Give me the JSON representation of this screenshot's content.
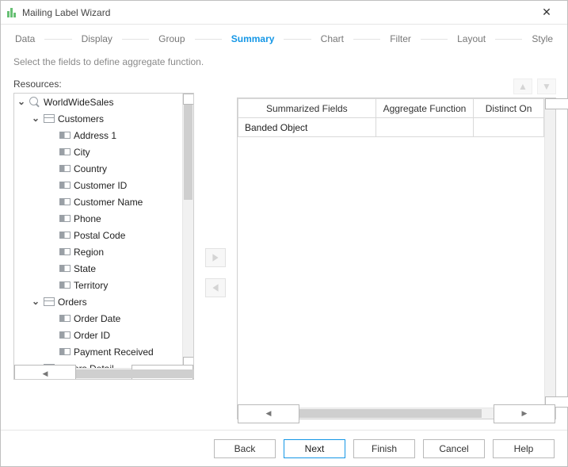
{
  "window": {
    "title": "Mailing Label Wizard"
  },
  "steps": {
    "items": [
      "Data",
      "Display",
      "Group",
      "Summary",
      "Chart",
      "Filter",
      "Layout",
      "Style"
    ],
    "active_index": 3
  },
  "instruction": "Select the fields to define aggregate function.",
  "left": {
    "label": "Resources:"
  },
  "tree": {
    "root": "WorldWideSales",
    "customers": {
      "label": "Customers",
      "fields": [
        "Address 1",
        "City",
        "Country",
        "Customer ID",
        "Customer Name",
        "Phone",
        "Postal Code",
        "Region",
        "State",
        "Territory"
      ]
    },
    "orders": {
      "label": "Orders",
      "fields": [
        "Order Date",
        "Order ID",
        "Payment Received"
      ]
    },
    "orders_detail": {
      "label": "Orders Detail"
    }
  },
  "grid": {
    "headers": [
      "Summarized Fields",
      "Aggregate Function",
      "Distinct On"
    ],
    "rows": [
      {
        "summarized": "Banded Object",
        "aggregate": "",
        "distinct": ""
      }
    ]
  },
  "buttons": {
    "back": "Back",
    "next": "Next",
    "finish": "Finish",
    "cancel": "Cancel",
    "help": "Help"
  }
}
